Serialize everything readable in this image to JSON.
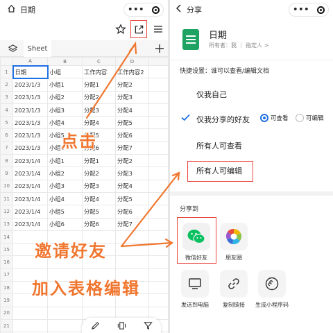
{
  "left": {
    "title": "日期",
    "sheet_tab": "Sheet",
    "columns": [
      "A",
      "B",
      "C",
      "D"
    ],
    "headers": [
      "日期",
      "小组",
      "工作内容",
      "工作内容2"
    ],
    "rows": [
      [
        "2023/1/3",
        "小组1",
        "分配1",
        "分配2"
      ],
      [
        "2023/1/3",
        "小组2",
        "分配2",
        "分配3"
      ],
      [
        "2023/1/3",
        "小组3",
        "分配3",
        "分配4"
      ],
      [
        "2023/1/3",
        "小组4",
        "分配4",
        "分配5"
      ],
      [
        "2023/1/3",
        "小组5",
        "分配5",
        "分配6"
      ],
      [
        "2023/1/3",
        "小组6",
        "分配6",
        "分配7"
      ],
      [
        "2023/1/4",
        "小组1",
        "分配1",
        "分配2"
      ],
      [
        "2023/1/4",
        "小组2",
        "分配2",
        "分配3"
      ],
      [
        "2023/1/4",
        "小组3",
        "分配3",
        "分配4"
      ],
      [
        "2023/1/4",
        "小组4",
        "分配4",
        "分配5"
      ],
      [
        "2023/1/4",
        "小组5",
        "分配5",
        "分配6"
      ],
      [
        "2023/1/4",
        "小组6",
        "分配6",
        "分配7"
      ]
    ],
    "empty_rows": 9,
    "annotations": {
      "click": "点击",
      "invite": "邀请好友",
      "join": "加入表格编辑"
    }
  },
  "right": {
    "back_title": "分享",
    "doc_title": "日期",
    "owner": "所有者：我 ｜ 指定人 >",
    "setting_label": "快捷设置：谁可以查看/编辑文档",
    "options": {
      "only_me": "仅我自己",
      "friends": "仅我分享的好友",
      "anyone_view": "所有人可查看",
      "anyone_edit": "所有人可编辑"
    },
    "radio_view": "可查看",
    "radio_edit": "可编辑",
    "share_to": "分享到",
    "targets": {
      "wechat": "微信好友",
      "moments": "朋友圈",
      "pc": "发送到电脑",
      "copy": "复制链接",
      "qrcode": "生成小程序码"
    }
  },
  "colors": {
    "accent": "#1f6fe5",
    "annotation": "#f0762f",
    "highlight_box": "#e8473d",
    "wechat_green": "#07c160"
  }
}
